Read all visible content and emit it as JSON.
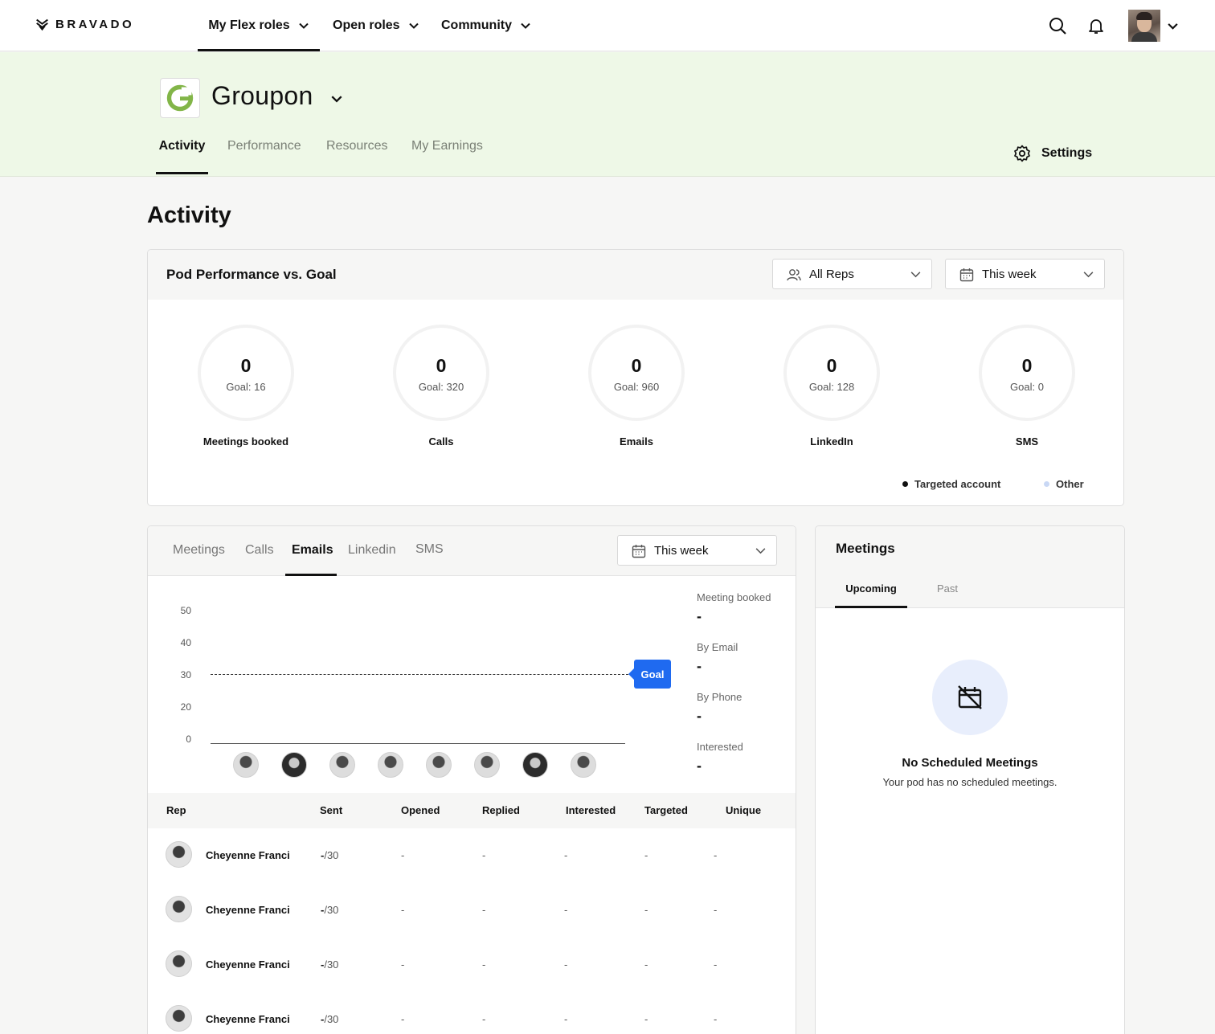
{
  "brand": {
    "name": "BRAVADO"
  },
  "topnav": {
    "items": [
      {
        "label": "My Flex roles"
      },
      {
        "label": "Open roles"
      },
      {
        "label": "Community"
      }
    ],
    "icons": [
      "search-icon",
      "bell-icon",
      "avatar",
      "chevron-down-icon"
    ]
  },
  "company": {
    "initial": "G",
    "name": "Groupon",
    "tabs": [
      {
        "label": "Activity"
      },
      {
        "label": "Performance"
      },
      {
        "label": "Resources"
      },
      {
        "label": "My Earnings"
      }
    ],
    "settings_label": "Settings"
  },
  "page": {
    "title": "Activity"
  },
  "pod": {
    "title": "Pod Performance vs. Goal",
    "reps_filter": "All Reps",
    "period_filter": "This week",
    "metrics": [
      {
        "value": "0",
        "goal": "Goal: 16",
        "label": "Meetings booked"
      },
      {
        "value": "0",
        "goal": "Goal: 320",
        "label": "Calls"
      },
      {
        "value": "0",
        "goal": "Goal: 960",
        "label": "Emails"
      },
      {
        "value": "0",
        "goal": "Goal: 128",
        "label": "LinkedIn"
      },
      {
        "value": "0",
        "goal": "Goal: 0",
        "label": "SMS"
      }
    ],
    "legend": [
      {
        "label": "Targeted account",
        "color": "#111111"
      },
      {
        "label": "Other",
        "color": "#c9d8f5"
      }
    ]
  },
  "activity": {
    "tabs": [
      {
        "label": "Meetings"
      },
      {
        "label": "Calls"
      },
      {
        "label": "Emails"
      },
      {
        "label": "Linkedin"
      },
      {
        "label": "SMS"
      }
    ],
    "period_filter": "This week",
    "stats": [
      {
        "label": "Meeting booked",
        "value": "-"
      },
      {
        "label": "By Email",
        "value": "-"
      },
      {
        "label": "By Phone",
        "value": "-"
      },
      {
        "label": "Interested",
        "value": "-"
      }
    ],
    "table": {
      "columns": [
        "Rep",
        "Sent",
        "Opened",
        "Replied",
        "Interested",
        "Targeted",
        "Unique"
      ],
      "rows": [
        {
          "rep": "Cheyenne Franci",
          "sent": "-",
          "sent_goal": "/30",
          "opened": "-",
          "replied": "-",
          "interested": "-",
          "targeted": "-",
          "unique": "-"
        },
        {
          "rep": "Cheyenne Franci",
          "sent": "-",
          "sent_goal": "/30",
          "opened": "-",
          "replied": "-",
          "interested": "-",
          "targeted": "-",
          "unique": "-"
        },
        {
          "rep": "Cheyenne Franci",
          "sent": "-",
          "sent_goal": "/30",
          "opened": "-",
          "replied": "-",
          "interested": "-",
          "targeted": "-",
          "unique": "-"
        },
        {
          "rep": "Cheyenne Franci",
          "sent": "-",
          "sent_goal": "/30",
          "opened": "-",
          "replied": "-",
          "interested": "-",
          "targeted": "-",
          "unique": "-"
        }
      ]
    }
  },
  "chart_data": {
    "type": "bar",
    "categories": [
      "",
      "",
      "",
      "",
      "",
      "",
      "",
      ""
    ],
    "values": [
      0,
      0,
      0,
      0,
      0,
      0,
      0,
      0
    ],
    "title": "",
    "xlabel": "",
    "ylabel": "",
    "ylim": [
      0,
      50
    ],
    "yticks": [
      0,
      10,
      20,
      30,
      40,
      50
    ],
    "ytick_labels": [
      "0",
      "20",
      "30",
      "40",
      "50"
    ],
    "goal": {
      "label": "Goal",
      "value": 30
    },
    "grid": false
  },
  "meetings": {
    "title": "Meetings",
    "tabs": [
      {
        "label": "Upcoming"
      },
      {
        "label": "Past"
      }
    ],
    "empty_title": "No Scheduled Meetings",
    "empty_subtitle": "Your pod has no scheduled meetings."
  }
}
